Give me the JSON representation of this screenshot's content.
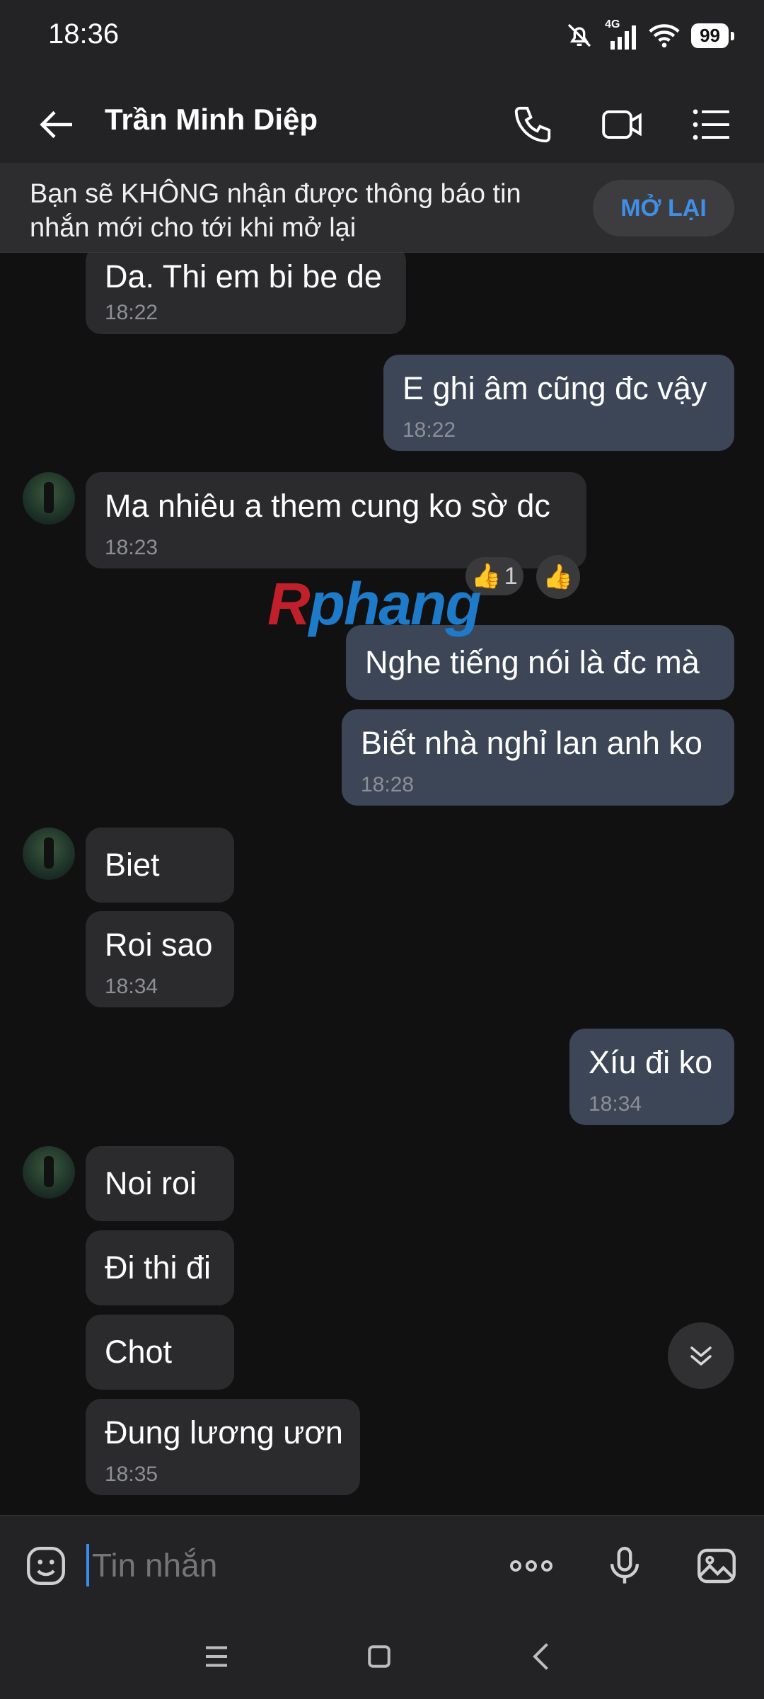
{
  "status": {
    "time": "18:36",
    "network": "4G",
    "battery": "99"
  },
  "header": {
    "contact_name": "Trần Minh Diệp"
  },
  "banner": {
    "text": "Bạn sẽ KHÔNG nhận được thông báo tin nhắn mới cho tới khi mở lại",
    "button": "MỞ LẠI"
  },
  "messages": [
    {
      "dir": "in",
      "text": "Da. Thi em bi be de",
      "time": "18:22"
    },
    {
      "dir": "out",
      "text": "E ghi âm cũng đc vậy",
      "time": "18:22"
    },
    {
      "dir": "in",
      "text": "Ma nhiêu a them cung ko sờ dc",
      "time": "18:23",
      "reaction_count": "1"
    },
    {
      "dir": "out",
      "text": "Nghe tiếng nói là đc mà"
    },
    {
      "dir": "out",
      "text": "Biết nhà nghỉ lan anh ko",
      "time": "18:28"
    },
    {
      "dir": "in",
      "text": "Biet"
    },
    {
      "dir": "in",
      "text": "Roi sao",
      "time": "18:34"
    },
    {
      "dir": "out",
      "text": "Xíu đi ko",
      "time": "18:34"
    },
    {
      "dir": "in",
      "text": "Noi roi"
    },
    {
      "dir": "in",
      "text": "Đi thi đi"
    },
    {
      "dir": "in",
      "text": "Chot"
    },
    {
      "dir": "in",
      "text": "Đung lương ươn",
      "time": "18:35"
    }
  ],
  "watermark": {
    "part1": "R",
    "part2": "phang"
  },
  "composer": {
    "placeholder": "Tin nhắn"
  },
  "icons": {
    "back": "arrow-left-icon",
    "call": "phone-icon",
    "video": "video-icon",
    "menu": "list-menu-icon",
    "emoji": "sticker-icon",
    "more": "more-dots-icon",
    "mic": "microphone-icon",
    "image": "image-icon",
    "scroll": "double-chevron-down-icon",
    "reaction": "thumbs-up-icon"
  },
  "colors": {
    "accent": "#3f8fe6",
    "incoming_bubble": "#2b2b2d",
    "outgoing_bubble": "#3c4656"
  }
}
